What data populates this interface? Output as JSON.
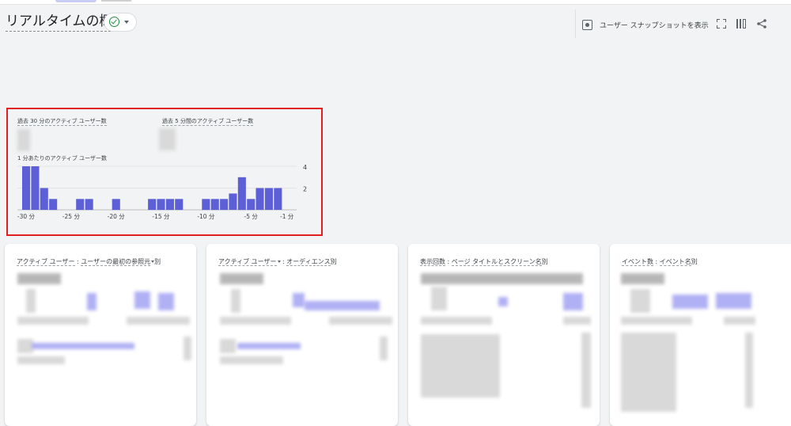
{
  "header": {
    "title": "リアルタイムの概要",
    "snapshot_label": "ユーザー スナップショットを表示",
    "icons": [
      "check-circle-icon",
      "chevron-down-icon",
      "snapshot-icon",
      "fullscreen-icon",
      "compare-icon",
      "share-icon"
    ]
  },
  "kpis": {
    "active_30": "過去 30 分のアクティブ ユーザー数",
    "active_5": "過去 5 分間のアクティブ ユーザー数"
  },
  "chart_data": {
    "type": "bar",
    "title": "1 分あたりのアクティブ ユーザー数",
    "x_tick_labels": [
      "-30 分",
      "-25 分",
      "-20 分",
      "-15 分",
      "-10 分",
      "-5 分",
      "-1 分"
    ],
    "y_tick_labels": [
      "4",
      "2"
    ],
    "ylim": [
      0,
      4
    ],
    "categories": [
      "-30",
      "-29",
      "-28",
      "-27",
      "-26",
      "-25",
      "-24",
      "-23",
      "-22",
      "-21",
      "-20",
      "-19",
      "-18",
      "-17",
      "-16",
      "-15",
      "-14",
      "-13",
      "-12",
      "-11",
      "-10",
      "-9",
      "-8",
      "-7",
      "-6",
      "-5",
      "-4",
      "-3",
      "-2",
      "-1"
    ],
    "values": [
      4,
      4,
      2,
      1,
      0,
      0,
      1,
      1,
      0,
      0,
      1,
      0,
      0,
      0,
      1,
      1,
      1,
      1,
      0,
      0,
      1,
      1,
      1,
      1.5,
      3,
      1,
      2,
      2,
      2,
      0
    ],
    "grid": true,
    "bar_color": "#5c5fd6"
  },
  "cards": [
    {
      "prefix": "アクティブ ユーザー",
      "sep": " : ",
      "dim": "ユーザーの最初の参照元",
      "dropdown": "dim",
      "suffix": "別"
    },
    {
      "prefix": "アクティブ ユーザー",
      "sep": " : ",
      "dim": "オーディエンス",
      "dropdown": "prefix",
      "suffix": "別"
    },
    {
      "prefix": "表示回数",
      "sep": " : ",
      "dim": "ページ タイトルとスクリーン名",
      "dropdown": "",
      "suffix": "別"
    },
    {
      "prefix": "イベント数",
      "sep": " : ",
      "dim": "イベント名",
      "dropdown": "",
      "suffix": "別"
    }
  ],
  "colors": {
    "accent": "#5c5fd6",
    "highlight_frame": "#e02020",
    "ok": "#1e8e3e"
  }
}
